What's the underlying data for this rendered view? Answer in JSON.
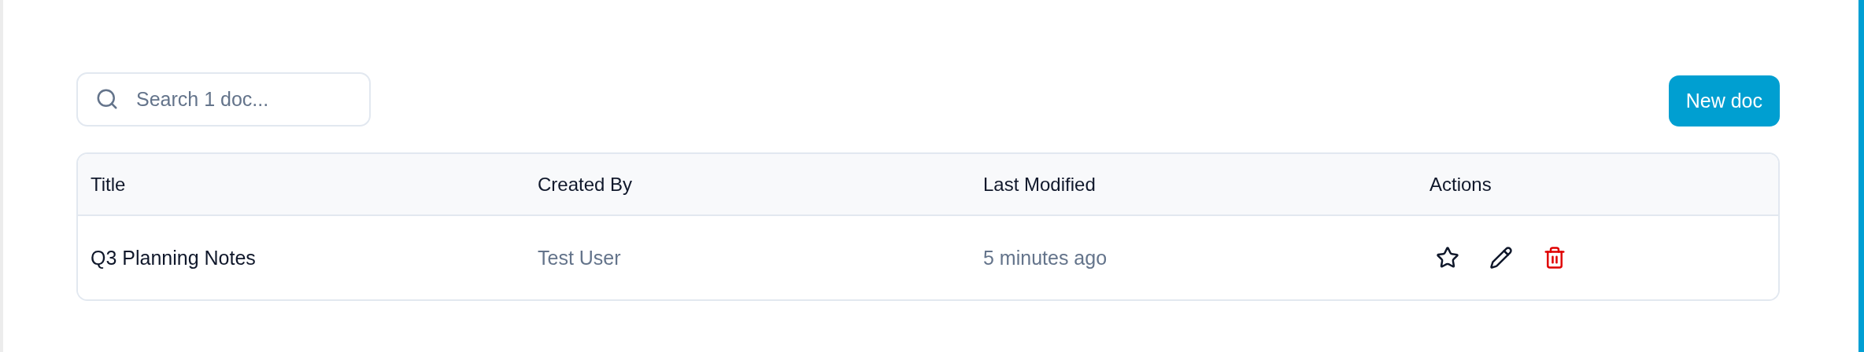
{
  "search": {
    "placeholder": "Search 1 doc..."
  },
  "new_button": "New doc",
  "table": {
    "columns": [
      "Title",
      "Created By",
      "Last Modified",
      "Actions"
    ],
    "rows": [
      {
        "title": "Q3 Planning Notes",
        "created_by": "Test User",
        "last_modified": "5 minutes ago",
        "starred": false
      }
    ]
  }
}
